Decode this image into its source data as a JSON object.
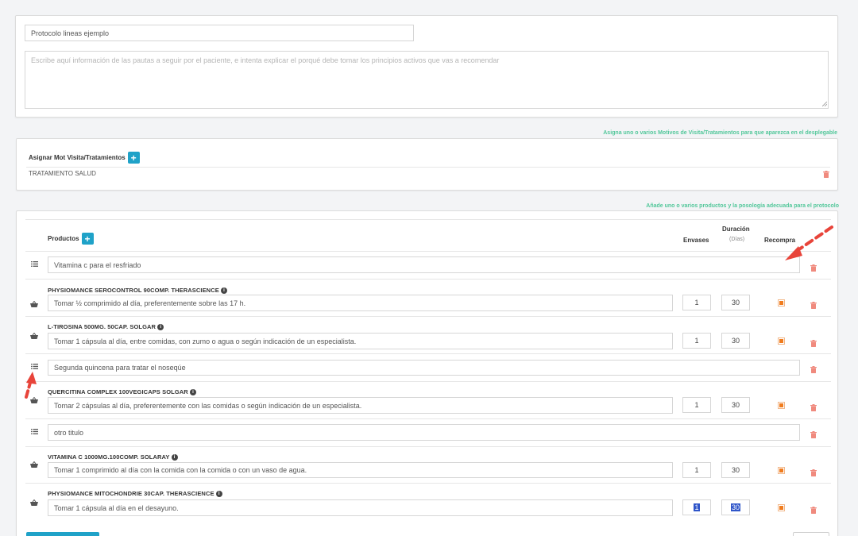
{
  "protocol": {
    "name_value": "Protocolo lineas ejemplo",
    "description_placeholder": "Escribe aquí información de las pautas a seguir por el paciente, e intenta explicar el porqué debe tomar los principios activos que vas a recomendar"
  },
  "motivos": {
    "hint": "Asigna uno o varios Motivos de Visita/Tratamientos para que aparezca en el desplegable",
    "title": "Asignar Mot Visita/Tratamientos",
    "add_label": "+",
    "items": [
      {
        "label": "TRATAMIENTO SALUD"
      }
    ]
  },
  "productos": {
    "hint": "Añade uno o varios productos y la posología adecuada para el protocolo",
    "title": "Productos",
    "add_label": "+",
    "col_envases": "Envases",
    "col_duracion": "Duración",
    "col_duracion_sub": "(Días)",
    "col_recompra": "Recompra",
    "rows": [
      {
        "type": "title",
        "text": "Vitamina c para el resfriado"
      },
      {
        "type": "product",
        "name": "PHYSIOMANCE SEROCONTROL 90COMP. THERASCIENCE",
        "dosage": "Tomar ½ comprimido al día, preferentemente sobre las 17 h.",
        "envases": "1",
        "duracion": "30",
        "recompra": true
      },
      {
        "type": "product",
        "name": "L-TIROSINA 500MG. 50CAP. SOLGAR",
        "dosage": "Tomar 1 cápsula al día, entre comidas, con zumo o agua o según indicación de un especialista.",
        "envases": "1",
        "duracion": "30",
        "recompra": true
      },
      {
        "type": "title",
        "text": "Segunda quincena para tratar el noseqúe"
      },
      {
        "type": "product",
        "name": "QUERCITINA COMPLEX 100VEGICAPS SOLGAR",
        "dosage": "Tomar 2 cápsulas al día, preferentemente con las comidas o según indicación de un especialista.",
        "envases": "1",
        "duracion": "30",
        "recompra": true
      },
      {
        "type": "title",
        "text": "otro titulo"
      },
      {
        "type": "product",
        "name": "VITAMINA C 1000MG.100COMP. SOLARAY",
        "dosage": "Tomar 1 comprimido al día con la comida con la comida o con un vaso de agua.",
        "envases": "1",
        "duracion": "30",
        "recompra": true
      },
      {
        "type": "product",
        "name": "PHYSIOMANCE MITOCHONDRIE 30CAP. THERASCIENCE",
        "dosage": "Tomar 1 cápsula al día en el desayuno.",
        "envases": "1",
        "duracion": "30",
        "recompra": true
      }
    ]
  },
  "colors": {
    "accent": "#1fa2c8",
    "hint_green": "#52c79a",
    "trash_red": "#f08a7e",
    "checkbox_orange": "#f07c1e",
    "arrow_red": "#e8443a"
  },
  "icons": {
    "list": "list-icon",
    "basket": "basket-icon",
    "trash": "trash-icon",
    "info": "info-icon"
  }
}
